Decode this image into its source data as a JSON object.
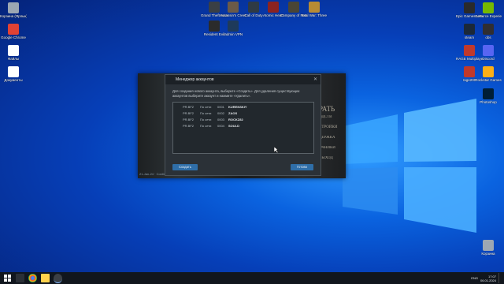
{
  "desktop_icons_left": [
    {
      "label": "Корзина (Ярлык)",
      "color": "#9ca7b3"
    },
    {
      "label": "Google Chrome",
      "color": "#e14234"
    },
    {
      "label": "Файлы",
      "color": "#ffffff"
    },
    {
      "label": "Документы",
      "color": "#ffffff"
    }
  ],
  "desktop_icons_top": [
    {
      "label": "Grand Theft Auto V",
      "color": "#3a3f44"
    },
    {
      "label": "Assassin's Creed",
      "color": "#6b5a48"
    },
    {
      "label": "Call of Duty",
      "color": "#2f3a44"
    },
    {
      "label": "Atomic Heart",
      "color": "#8b2320"
    },
    {
      "label": "Company of Heroes",
      "color": "#4a4535"
    },
    {
      "label": "Total War: Three K.",
      "color": "#b88b34"
    },
    {
      "label": "Resident Evil",
      "color": "#2b2b2b"
    },
    {
      "label": "radmin VPN",
      "color": "#1e3a5a"
    }
  ],
  "desktop_icons_right": [
    {
      "label": "Epic Games Launcher",
      "color": "#2a2a2a"
    },
    {
      "label": "GeForce Experience",
      "color": "#76b900"
    },
    {
      "label": "steam",
      "color": "#1b2838"
    },
    {
      "label": "obs",
      "color": "#302e31"
    },
    {
      "label": "RAGE Multiplayer",
      "color": "#c0392b"
    },
    {
      "label": "Discord",
      "color": "#5865f2"
    },
    {
      "label": "rage200",
      "color": "#c0392b"
    },
    {
      "label": "Rockstar Games",
      "color": "#fcaf17"
    },
    {
      "label": "Photoshop",
      "color": "#001e36"
    },
    {
      "label": "Корзина",
      "color": "#9ca7b3"
    }
  ],
  "app_side_words": [
    "РАТЬ",
    "ОДСТВ",
    "СТРОЙКИ",
    "ДЕРЖКА",
    "ОЧНИКИ",
    "ВЫХОД"
  ],
  "app_footer": "21-Jan-24 · Continuing voice chat server...",
  "dialog": {
    "title": "Менеджер аккаунтов",
    "description": "Для создания нового аккаунта, выберите «Создать». Для удаления существующих аккаунтов выберите аккаунт и нажмите «Удалить».",
    "rows": [
      {
        "c1": "PR.BF2",
        "c2": "По сети",
        "c3": "0001",
        "name": "KURENSKIY"
      },
      {
        "c1": "PR.BF2",
        "c2": "По сети",
        "c3": "0002",
        "name": "ZAOS"
      },
      {
        "c1": "PR.BF2",
        "c2": "По сети",
        "c3": "0003",
        "name": "ROCKZ82"
      },
      {
        "c1": "PR.BF2",
        "c2": "По сети",
        "c3": "0004",
        "name": "SOULD"
      }
    ],
    "create_label": "Создать",
    "ok_label": "Готово"
  },
  "taskbar": {
    "lang": "ENG",
    "time": "17:07",
    "date": "06.01.2024"
  }
}
